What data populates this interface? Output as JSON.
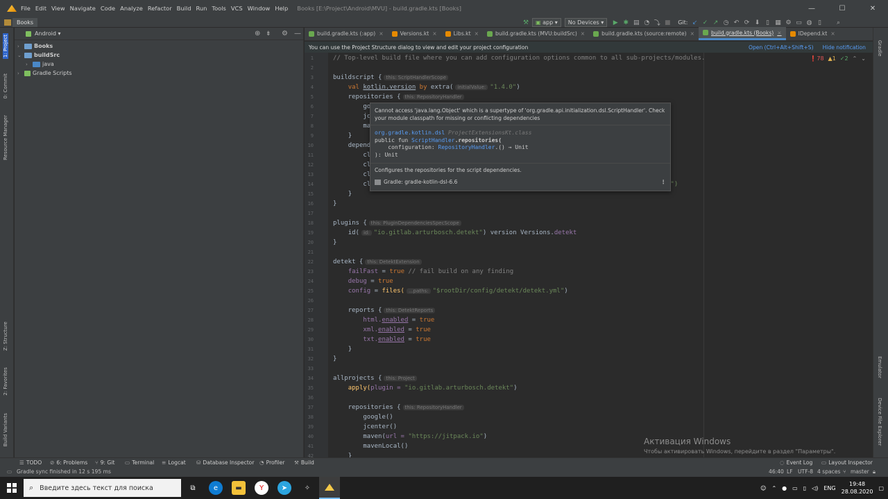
{
  "titlebar": {
    "menus": [
      "File",
      "Edit",
      "View",
      "Navigate",
      "Code",
      "Analyze",
      "Refactor",
      "Build",
      "Run",
      "Tools",
      "VCS",
      "Window",
      "Help"
    ],
    "title": "Books [E:\\Project\\Android\\MVU] - build.gradle.kts [Books]",
    "min": "—",
    "max": "☐",
    "close": "✕"
  },
  "navbar": {
    "crumb": "Books",
    "config": "app",
    "device": "No Devices",
    "git_label": "Git:"
  },
  "left_strip": [
    "1: Project",
    "0: Commit",
    "Resource Manager",
    "Z: Structure",
    "2: Favorites",
    "Build Variants"
  ],
  "right_strip": [
    "Gradle",
    "Emulator",
    "Device File Explorer"
  ],
  "project": {
    "view": "Android",
    "tree": [
      {
        "label": "Books"
      },
      {
        "label": "buildSrc"
      },
      {
        "label": "java"
      },
      {
        "label": "Gradle Scripts"
      }
    ]
  },
  "tabs": [
    {
      "label": "build.gradle.kts (:app)",
      "color": "#6aa84f"
    },
    {
      "label": "Versions.kt",
      "color": "#e68a00"
    },
    {
      "label": "Libs.kt",
      "color": "#e68a00"
    },
    {
      "label": "build.gradle.kts (MVU:buildSrc)",
      "color": "#6aa84f"
    },
    {
      "label": "build.gradle.kts (source:remote)",
      "color": "#6aa84f"
    },
    {
      "label": "build.gradle.kts (Books)",
      "color": "#6aa84f",
      "active": true
    },
    {
      "label": "IDepend.kt",
      "color": "#e68a00"
    }
  ],
  "banner": {
    "text": "You can use the Project Structure dialog to view and edit your project configuration",
    "open": "Open (Ctrl+Alt+Shift+S)",
    "hide": "Hide notification"
  },
  "inspections": {
    "errors": "78",
    "warnings": "1",
    "ok": "2"
  },
  "line_numbers": [
    "1",
    "2",
    "3",
    "4",
    "5",
    "6",
    "7",
    "8",
    "9",
    "10",
    "11",
    "12",
    "13",
    "14",
    "15",
    "16",
    "17",
    "18",
    "19",
    "20",
    "21",
    "22",
    "23",
    "24",
    "25",
    "26",
    "27",
    "28",
    "29",
    "30",
    "31",
    "32",
    "33",
    "34",
    "35",
    "36",
    "37",
    "38",
    "39",
    "40",
    "41",
    "42"
  ],
  "code": {
    "l1": "// Top-level build file where you can add configuration options common to all sub-projects/modules.",
    "l3a": "buildscript {",
    "l3h": "this: ScriptHandlerScope",
    "l4a": "val ",
    "l4b": "kotlin.version",
    "l4c": " by ",
    "l4d": "extra(",
    "l4h": "initialValue:",
    "l4e": "\"1.4.0\"",
    "l4f": ")",
    "l5a": "repositories {",
    "l5h": "this: RepositoryHandler",
    "l6": "go",
    "l7": "jc",
    "l8": "ma",
    "l9": "}",
    "l10": "depende",
    "l11": "cl",
    "l12": "cl",
    "l13": "cl",
    "l14": "cl",
    "l14tail": "n\")",
    "l15": "}",
    "l16": "}",
    "l18a": "plugins {",
    "l18h": "this: PluginDependenciesSpecScope",
    "l19a": "id(",
    "l19h": "id:",
    "l19b": "\"io.gitlab.arturbosch.detekt\"",
    "l19c": ") ",
    "l19d": "version",
    "l19e": " Versions.",
    "l19f": "detekt",
    "l20": "}",
    "l22a": "detekt {",
    "l22h": "this: DetektExtension",
    "l23a": "failFast",
    "l23b": " = ",
    "l23c": "true",
    "l23d": " // fail build on any finding",
    "l24a": "debug",
    "l24b": " = ",
    "l24c": "true",
    "l25a": "config",
    "l25b": " = ",
    "l25c": "files(",
    "l25h": "...paths:",
    "l25d": "\"$rootDir/config/detekt/detekt.yml\"",
    "l25e": ")",
    "l27a": "reports {",
    "l27h": "this: DetektReports",
    "l28a": "html.",
    "l28b": "enabled",
    "l28c": " = ",
    "l28d": "true",
    "l29a": "xml.",
    "l29b": "enabled",
    "l29c": " = ",
    "l29d": "true",
    "l30a": "txt.",
    "l30b": "enabled",
    "l30c": " = ",
    "l30d": "true",
    "l31": "}",
    "l32": "}",
    "l34a": "allprojects {",
    "l34h": "this: Project",
    "l35a": "apply(",
    "l35b": "plugin = ",
    "l35c": "\"io.gitlab.arturbosch.detekt\"",
    "l35d": ")",
    "l37a": "repositories {",
    "l37h": "this: RepositoryHandler",
    "l38": "google()",
    "l39": "jcenter()",
    "l40a": "maven(",
    "l40b": "url = ",
    "l40c": "\"https://jitpack.io\"",
    "l40d": ")",
    "l41": "mavenLocal()",
    "l42": "}"
  },
  "popup": {
    "error": "Cannot access 'java.lang.Object' which is a supertype of 'org.gradle.api.initialization.dsl.ScriptHandler'. Check your module classpath for missing or conflicting dependencies",
    "pkg": "org.gradle.kotlin.dsl",
    "cls": "ProjectExtensionsKt.class",
    "sig1": "public fun ",
    "sig1b": "ScriptHandler",
    "sig1c": ".repositories(",
    "sig2a": "    configuration: ",
    "sig2b": "RepositoryHandler",
    "sig2c": ".() → Unit",
    "sig3": "): Unit",
    "doc": "Configures the repositories for the script dependencies.",
    "source": "Gradle: gradle-kotlin-dsl-6.6"
  },
  "watermark": {
    "title": "Активация Windows",
    "text": "Чтобы активировать Windows, перейдите в раздел \"Параметры\"."
  },
  "toolwindows": [
    "TODO",
    "6: Problems",
    "9: Git",
    "Terminal",
    "Logcat",
    "Database Inspector",
    "Profiler",
    "Build"
  ],
  "toolwindows_right": [
    "Event Log",
    "Layout Inspector"
  ],
  "status": {
    "message": "Gradle sync finished in 12 s 195 ms",
    "position": "46:40",
    "line_sep": "LF",
    "encoding": "UTF-8",
    "indent": "4 spaces",
    "branch": "master"
  },
  "taskbar": {
    "search_placeholder": "Введите здесь текст для поиска",
    "lang": "ENG",
    "time": "19:48",
    "date": "28.08.2020"
  }
}
